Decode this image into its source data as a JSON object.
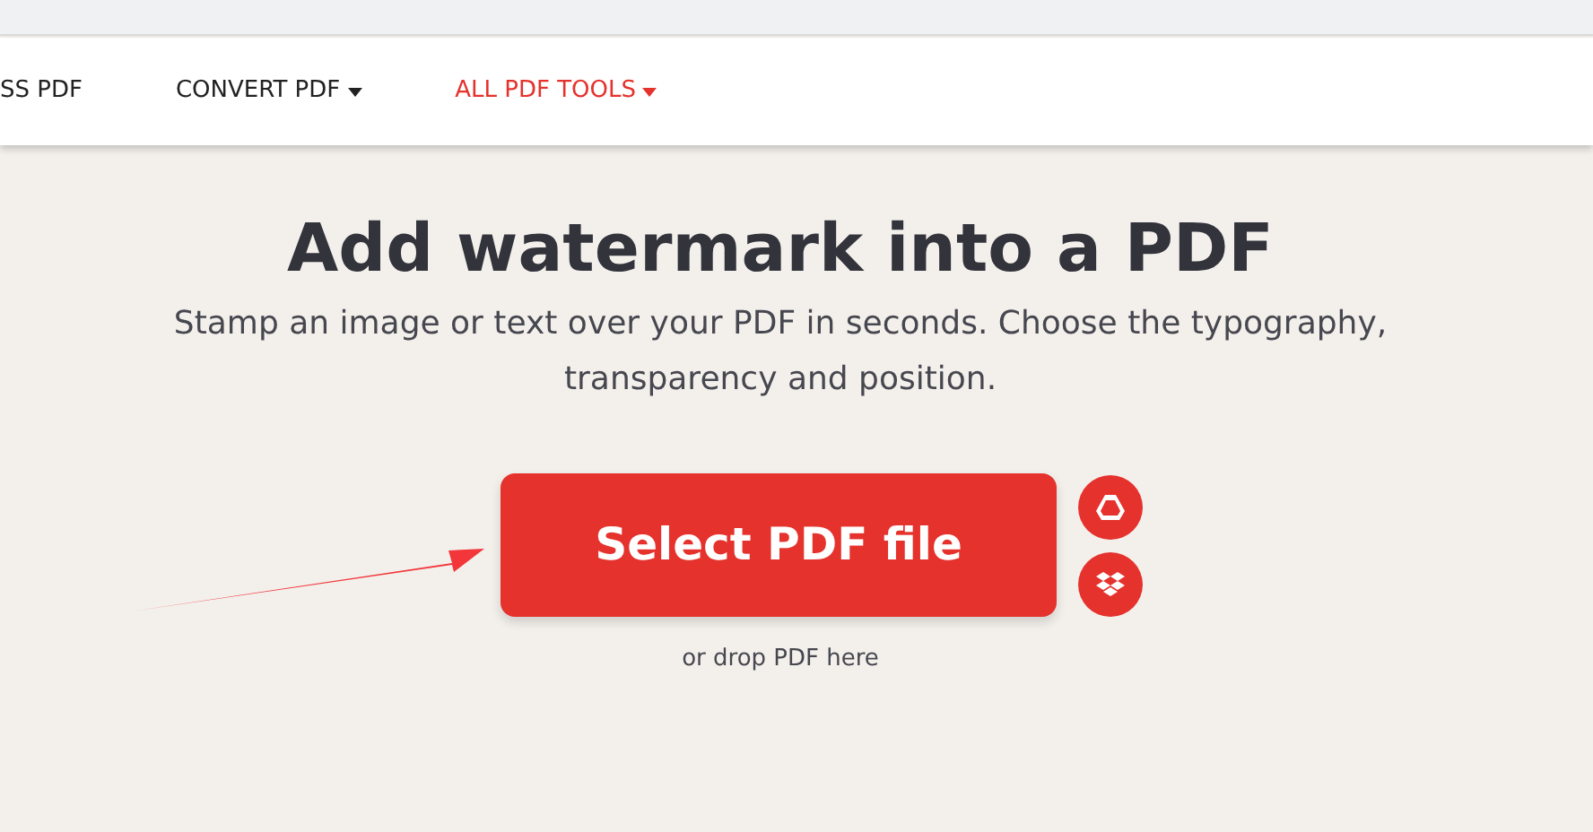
{
  "nav": {
    "items": [
      {
        "label": "SS PDF",
        "active": false,
        "dropdown": false
      },
      {
        "label": "CONVERT PDF",
        "active": false,
        "dropdown": true
      },
      {
        "label": "ALL PDF TOOLS",
        "active": true,
        "dropdown": true
      }
    ]
  },
  "hero": {
    "title": "Add watermark into a PDF",
    "subtitle": "Stamp an image or text over your PDF in seconds. Choose the typography, transparency and position.",
    "button": "Select PDF file",
    "hint": "or drop PDF here"
  }
}
